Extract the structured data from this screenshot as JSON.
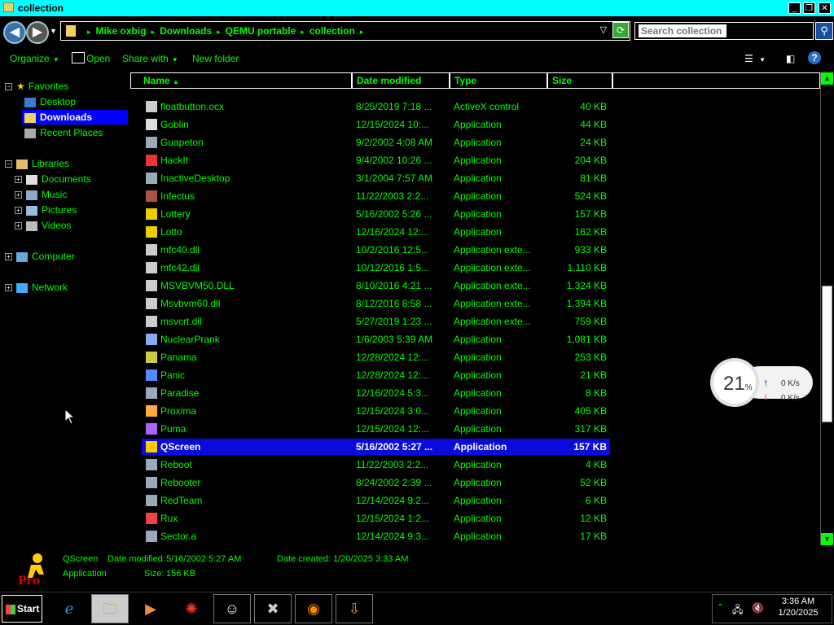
{
  "window": {
    "title": "collection"
  },
  "address": {
    "crumbs": [
      "Mike oxbig",
      "Downloads",
      "QEMU portable",
      "collection"
    ],
    "search_placeholder": "Search collection"
  },
  "toolbar": {
    "organize": "Organize",
    "open": "Open",
    "share_with": "Share with",
    "new_folder": "New folder"
  },
  "nav": {
    "favorites": "Favorites",
    "desktop": "Desktop",
    "downloads": "Downloads",
    "recent_places": "Recent Places",
    "libraries": "Libraries",
    "documents": "Documents",
    "music": "Music",
    "pictures": "Pictures",
    "videos": "Videos",
    "computer": "Computer",
    "network": "Network"
  },
  "columns": {
    "name": "Name",
    "date": "Date modified",
    "type": "Type",
    "size": "Size"
  },
  "files": [
    {
      "name": "floatbutton.ocx",
      "date": "8/25/2019 7:18 ...",
      "type": "ActiveX control",
      "size": "40 KB",
      "icon": "file-icon",
      "color": "#cccccc"
    },
    {
      "name": "Goblin",
      "date": "12/15/2024 10:...",
      "type": "Application",
      "size": "44 KB",
      "icon": "app-icon",
      "color": "#dddddd"
    },
    {
      "name": "Guapeton",
      "date": "9/2/2002 4:08 AM",
      "type": "Application",
      "size": "24 KB",
      "icon": "app-icon",
      "color": "#9ab"
    },
    {
      "name": "HackIt",
      "date": "9/4/2002 10:26 ...",
      "type": "Application",
      "size": "204 KB",
      "icon": "app-icon",
      "color": "#e33"
    },
    {
      "name": "InactiveDesktop",
      "date": "3/1/2004 7:57 AM",
      "type": "Application",
      "size": "81 KB",
      "icon": "app-icon",
      "color": "#9ab"
    },
    {
      "name": "Infectus",
      "date": "11/22/2003 2:2...",
      "type": "Application",
      "size": "524 KB",
      "icon": "app-icon",
      "color": "#a54"
    },
    {
      "name": "Lottery",
      "date": "5/16/2002 5:26 ...",
      "type": "Application",
      "size": "157 KB",
      "icon": "app-icon",
      "color": "#ec0"
    },
    {
      "name": "Lotto",
      "date": "12/16/2024 12:...",
      "type": "Application",
      "size": "162 KB",
      "icon": "app-icon",
      "color": "#ec0"
    },
    {
      "name": "mfc40.dll",
      "date": "10/2/2016 12:5...",
      "type": "Application exte...",
      "size": "933 KB",
      "icon": "dll-icon",
      "color": "#cccccc"
    },
    {
      "name": "mfc42.dll",
      "date": "10/12/2016 1:5...",
      "type": "Application exte...",
      "size": "1,110 KB",
      "icon": "dll-icon",
      "color": "#cccccc"
    },
    {
      "name": "MSVBVM50.DLL",
      "date": "8/10/2016 4:21 ...",
      "type": "Application exte...",
      "size": "1,324 KB",
      "icon": "dll-icon",
      "color": "#cccccc"
    },
    {
      "name": "Msvbvm60.dll",
      "date": "8/12/2016 8:58 ...",
      "type": "Application exte...",
      "size": "1,394 KB",
      "icon": "dll-icon",
      "color": "#cccccc"
    },
    {
      "name": "msvcrt.dll",
      "date": "5/27/2019 1:23 ...",
      "type": "Application exte...",
      "size": "759 KB",
      "icon": "dll-icon",
      "color": "#cccccc"
    },
    {
      "name": "NuclearPrank",
      "date": "1/6/2003 5:39 AM",
      "type": "Application",
      "size": "1,081 KB",
      "icon": "app-icon",
      "color": "#8ae"
    },
    {
      "name": "Panama",
      "date": "12/28/2024 12:...",
      "type": "Application",
      "size": "253 KB",
      "icon": "app-icon",
      "color": "#cc4"
    },
    {
      "name": "Panic",
      "date": "12/28/2024 12:...",
      "type": "Application",
      "size": "21 KB",
      "icon": "app-icon",
      "color": "#58f"
    },
    {
      "name": "Paradise",
      "date": "12/16/2024 5:3...",
      "type": "Application",
      "size": "8 KB",
      "icon": "app-icon",
      "color": "#9ab"
    },
    {
      "name": "Proxima",
      "date": "12/15/2024 3:0...",
      "type": "Application",
      "size": "405 KB",
      "icon": "app-icon",
      "color": "#fa4"
    },
    {
      "name": "Puma",
      "date": "12/15/2024 12:...",
      "type": "Application",
      "size": "317 KB",
      "icon": "app-icon",
      "color": "#a6f"
    },
    {
      "name": "QScreen",
      "date": "5/16/2002 5:27 ...",
      "type": "Application",
      "size": "157 KB",
      "icon": "app-icon",
      "color": "#fc0",
      "selected": true
    },
    {
      "name": "Reboot",
      "date": "11/22/2003 2:2...",
      "type": "Application",
      "size": "4 KB",
      "icon": "app-icon",
      "color": "#9ab"
    },
    {
      "name": "Rebooter",
      "date": "8/24/2002 2:39 ...",
      "type": "Application",
      "size": "52 KB",
      "icon": "app-icon",
      "color": "#9ab"
    },
    {
      "name": "RedTeam",
      "date": "12/14/2024 9:2...",
      "type": "Application",
      "size": "6 KB",
      "icon": "app-icon",
      "color": "#9ab"
    },
    {
      "name": "Rux",
      "date": "12/15/2024 1:2...",
      "type": "Application",
      "size": "12 KB",
      "icon": "app-icon",
      "color": "#e44"
    },
    {
      "name": "Sector.a",
      "date": "12/14/2024 9:3...",
      "type": "Application",
      "size": "17 KB",
      "icon": "app-icon",
      "color": "#9ab"
    }
  ],
  "details": {
    "name": "QScreen",
    "date_modified_label": "Date modified:",
    "date_modified": "5/16/2002 5:27 AM",
    "date_created_label": "Date created:",
    "date_created": "1/20/2025 3:33 AM",
    "type": "Application",
    "size_label": "Size:",
    "size": "156 KB"
  },
  "taskbar": {
    "start": "Start",
    "clock_time": "3:36 AM",
    "clock_date": "1/20/2025"
  },
  "gauge": {
    "percent": "21",
    "percent_sign": "%",
    "up": "0 K/s",
    "down": "0 K/s"
  }
}
